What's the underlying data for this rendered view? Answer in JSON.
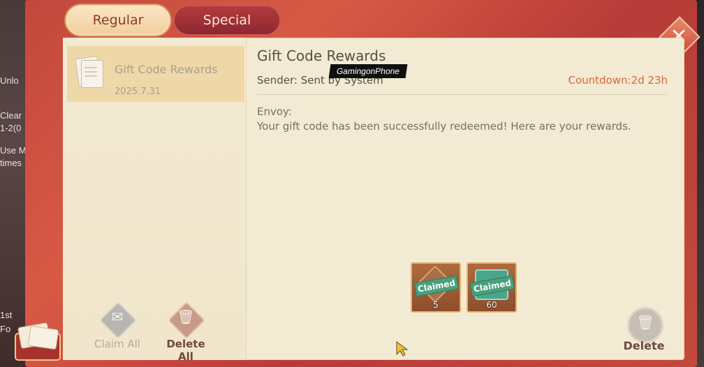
{
  "background": {
    "left_fragments": [
      "Unlo",
      "Clear",
      "1-2(0",
      "Use M",
      "times",
      "1st",
      "Fo"
    ]
  },
  "tabs": [
    {
      "label": "Regular",
      "active": true
    },
    {
      "label": "Special",
      "active": false
    }
  ],
  "close_icon": "close-x-icon",
  "mail_list": [
    {
      "title": "Gift Code Rewards",
      "date": "2025.7.31",
      "selected": true
    }
  ],
  "list_actions": {
    "claim_all": "Claim All",
    "delete_all": "Delete All"
  },
  "detail": {
    "title": "Gift Code Rewards",
    "sender": "Sender: Sent by System",
    "countdown": "Countdown:2d 23h",
    "greeting": "Envoy:",
    "body": "Your gift code has been successfully redeemed! Here are your rewards.",
    "rewards": [
      {
        "status": "Claimed",
        "count": "5",
        "icon": "compass-item-icon"
      },
      {
        "status": "Claimed",
        "count": "60",
        "icon": "jade-item-icon"
      }
    ],
    "delete_label": "Delete"
  },
  "watermark": "GamingonPhone",
  "colors": {
    "frame_red": "#c2483d",
    "panel": "#f3ead3",
    "selected_item": "#efd8a8",
    "countdown": "#d8663e",
    "claimed_green": "#4aa07c"
  }
}
